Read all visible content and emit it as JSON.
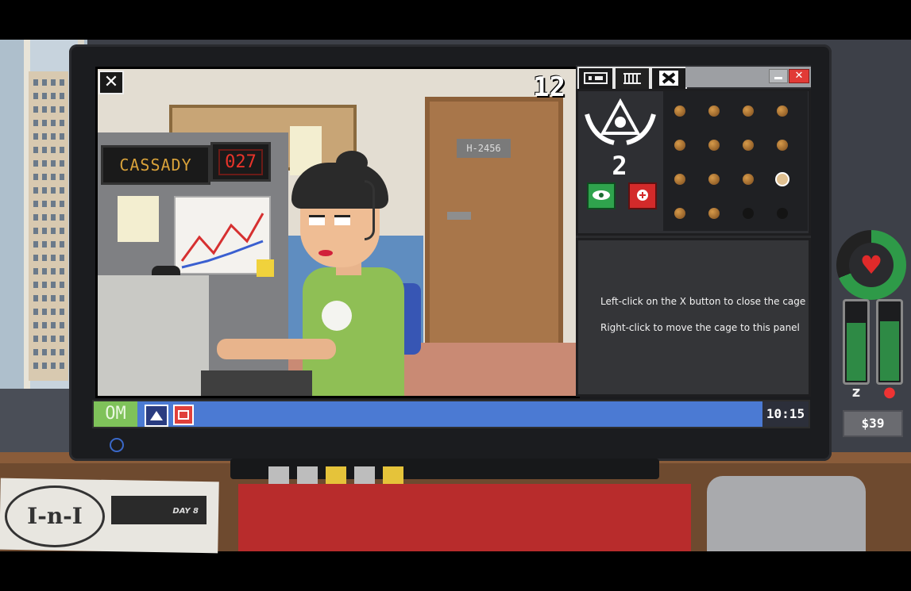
{
  "video": {
    "counter": "12",
    "name_plate": "CASSADY",
    "number_plate": "027",
    "door_sign": "H-2456"
  },
  "cage": {
    "count": "2",
    "help_lines": [
      "Left-click on the X button to close the cage",
      "Right-click to move the cage to this panel"
    ],
    "grid": [
      [
        "on",
        "on",
        "on",
        "on"
      ],
      [
        "on",
        "on",
        "on",
        "on"
      ],
      [
        "on",
        "on",
        "on",
        "selected"
      ],
      [
        "on",
        "on",
        "off",
        "off"
      ]
    ]
  },
  "taskbar": {
    "start_label": "OM",
    "clock": "10:15"
  },
  "hud": {
    "money": "$39",
    "health_fraction": 0.69,
    "sleep_fraction": 0.78,
    "hunger_fraction": 0.8
  },
  "desk": {
    "paper_logo": "I-n-I",
    "paper_day": "DAY 8"
  },
  "colors": {
    "taskbar": "#4b7ad3",
    "start": "#7fc25a",
    "status_green": "#2e8a45",
    "alert_red": "#d32a2a"
  }
}
